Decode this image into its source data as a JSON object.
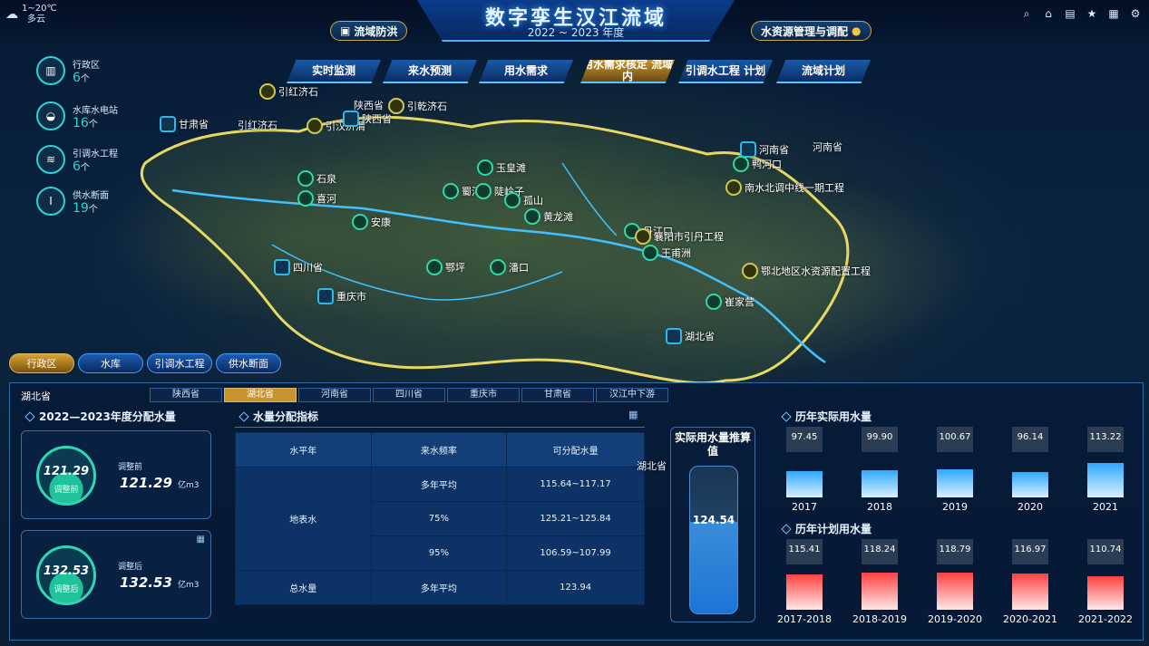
{
  "header": {
    "title": "数字孪生汉江流域",
    "period": "2022 ~ 2023 年度",
    "left_button": "流域防洪",
    "right_button": "水资源管理与调配",
    "weather_temp": "1~20℃",
    "weather_desc": "多云"
  },
  "toolbar_icons": [
    "search-icon",
    "home-icon",
    "document-icon",
    "star-icon",
    "grid-icon",
    "gear-icon"
  ],
  "nav_tabs": [
    {
      "label": "实时监测",
      "active": false
    },
    {
      "label": "来水预测",
      "active": false
    },
    {
      "label": "用水需求",
      "active": false
    },
    {
      "label": "用水需求核定 流域内",
      "active": true
    },
    {
      "label": "引调水工程 计划",
      "active": false
    },
    {
      "label": "流域计划",
      "active": false
    }
  ],
  "legend": [
    {
      "label": "行政区",
      "count": "6",
      "unit": "个",
      "icon": "building-icon"
    },
    {
      "label": "水库水电站",
      "count": "16",
      "unit": "个",
      "icon": "reservoir-icon"
    },
    {
      "label": "引调水工程",
      "count": "6",
      "unit": "个",
      "icon": "canal-icon"
    },
    {
      "label": "供水断面",
      "count": "19",
      "unit": "个",
      "icon": "section-icon"
    }
  ],
  "map_markers": [
    {
      "label": "引红济石",
      "type": "y"
    },
    {
      "label": "引乾济石",
      "type": "y"
    },
    {
      "label": "引汉济渭",
      "type": "y"
    },
    {
      "label": "陕西省",
      "type": "b"
    },
    {
      "label": "甘肃省",
      "type": "b"
    },
    {
      "label": "石泉",
      "type": "g"
    },
    {
      "label": "喜河",
      "type": "g"
    },
    {
      "label": "安康",
      "type": "g"
    },
    {
      "label": "蜀河",
      "type": "g"
    },
    {
      "label": "玉皇滩",
      "type": "g"
    },
    {
      "label": "陡岭子",
      "type": "g"
    },
    {
      "label": "孤山",
      "type": "g"
    },
    {
      "label": "黄龙滩",
      "type": "g"
    },
    {
      "label": "四川省",
      "type": "b"
    },
    {
      "label": "重庆市",
      "type": "b"
    },
    {
      "label": "鄂坪",
      "type": "g"
    },
    {
      "label": "潘口",
      "type": "g"
    },
    {
      "label": "河南省",
      "type": "b"
    },
    {
      "label": "鸭河口",
      "type": "g"
    },
    {
      "label": "南水北调中线一期工程",
      "type": "y"
    },
    {
      "label": "丹江口",
      "type": "g"
    },
    {
      "label": "襄阳市引丹工程",
      "type": "y"
    },
    {
      "label": "王甫洲",
      "type": "g"
    },
    {
      "label": "鄂北地区水资源配置工程",
      "type": "y"
    },
    {
      "label": "崔家营",
      "type": "g"
    },
    {
      "label": "湖北省",
      "type": "b"
    }
  ],
  "map_words": [
    "陕西省",
    "河南省",
    "引红济石",
    "湖北省"
  ],
  "categories": [
    {
      "label": "行政区",
      "active": true
    },
    {
      "label": "水库",
      "active": false
    },
    {
      "label": "引调水工程",
      "active": false
    },
    {
      "label": "供水断面",
      "active": false
    }
  ],
  "region_bar": {
    "current": "湖北省",
    "tabs": [
      {
        "label": "陕西省",
        "active": false
      },
      {
        "label": "湖北省",
        "active": true
      },
      {
        "label": "河南省",
        "active": false
      },
      {
        "label": "四川省",
        "active": false
      },
      {
        "label": "重庆市",
        "active": false
      },
      {
        "label": "甘肃省",
        "active": false
      },
      {
        "label": "汉江中下游",
        "active": false
      }
    ]
  },
  "allocation": {
    "title": "2022—2023年度分配水量",
    "before": {
      "gauge_value": "121.29",
      "gauge_label": "调整前",
      "label": "调整前",
      "value": "121.29",
      "unit": "亿m3"
    },
    "after": {
      "gauge_value": "132.53",
      "gauge_label": "调整后",
      "label": "调整后",
      "value": "132.53",
      "unit": "亿m3"
    }
  },
  "indicators": {
    "title": "水量分配指标",
    "headers": [
      "水平年",
      "来水频率",
      "可分配水量"
    ],
    "rows": [
      {
        "freq": "多年平均",
        "value": "115.64~117.17"
      },
      {
        "freq": "75%",
        "value": "125.21~125.84"
      },
      {
        "freq": "95%",
        "value": "106.59~107.99"
      }
    ],
    "group_label": "地表水",
    "total": {
      "label": "总水量",
      "freq": "多年平均",
      "value": "123.94"
    }
  },
  "actual_estimate": {
    "title": "实际用水量推算值",
    "value": "124.54"
  },
  "history_actual": {
    "title": "历年实际用水量",
    "chart_data": {
      "type": "bar",
      "categories": [
        "2017",
        "2018",
        "2019",
        "2020",
        "2021"
      ],
      "values": [
        97.45,
        99.9,
        100.67,
        96.14,
        113.22
      ],
      "labels": [
        "97.45",
        "99.90",
        "100.67",
        "96.14",
        "113.22"
      ]
    }
  },
  "history_plan": {
    "title": "历年计划用水量",
    "chart_data": {
      "type": "bar",
      "categories": [
        "2017-2018",
        "2018-2019",
        "2019-2020",
        "2020-2021",
        "2021-2022"
      ],
      "values": [
        115.41,
        118.24,
        118.79,
        116.97,
        110.74
      ],
      "labels": [
        "115.41",
        "118.24",
        "118.79",
        "116.97",
        "110.74"
      ]
    }
  },
  "colors": {
    "accent": "#2fd3d3",
    "gold": "#c69430",
    "blue_bar": "#2fa8ff",
    "red_bar": "#ff4040"
  }
}
